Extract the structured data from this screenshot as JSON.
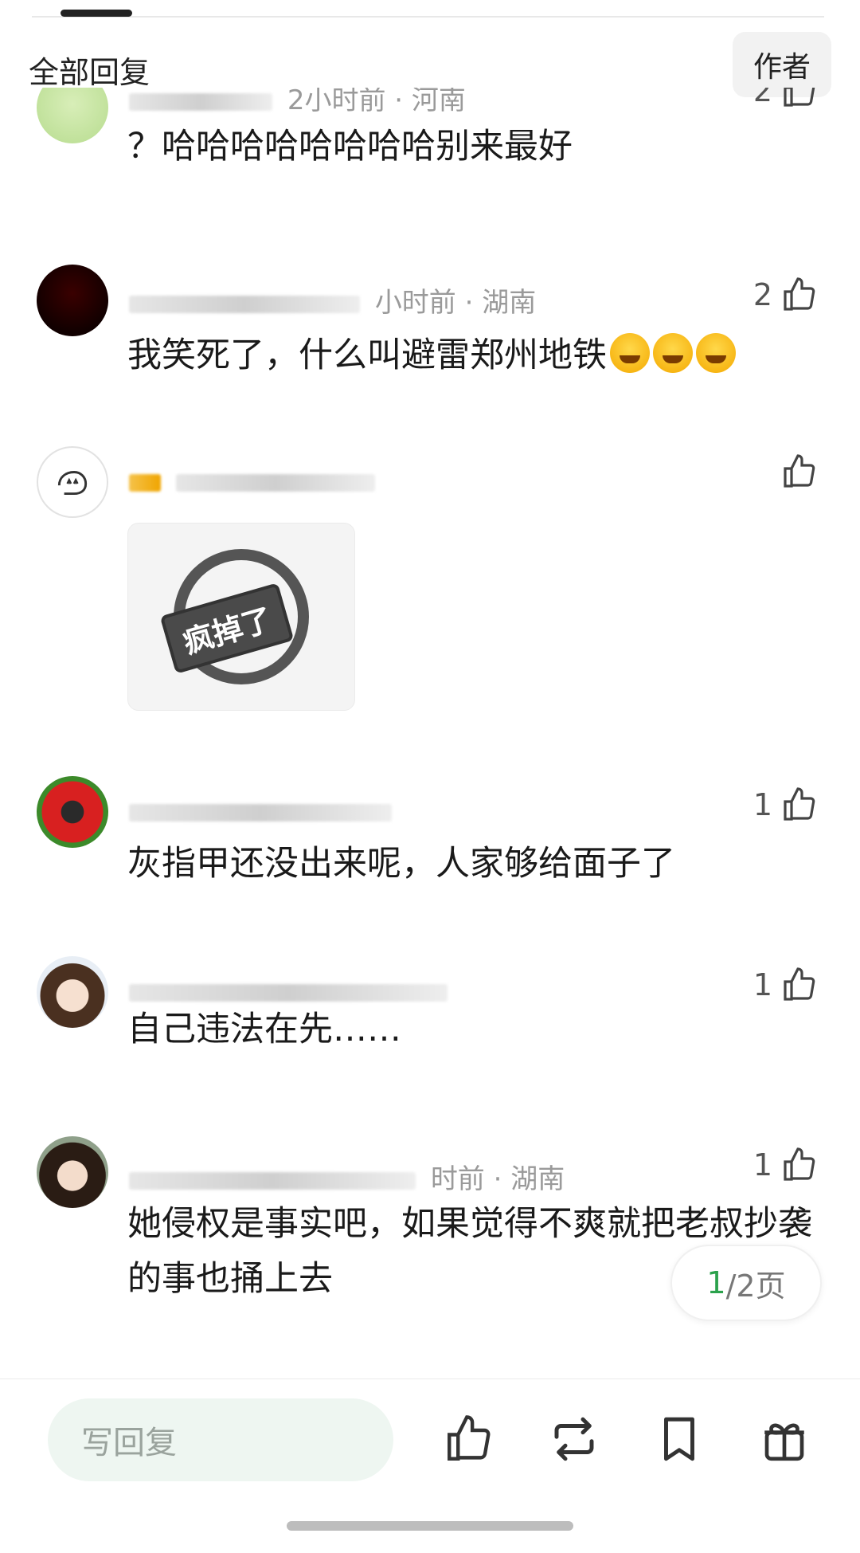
{
  "header": {
    "title": "全部回复",
    "author_button": "作者"
  },
  "comments": [
    {
      "meta": "2小时前 · 河南",
      "likes": "2",
      "text": "？哈哈哈哈哈哈哈哈别来最好"
    },
    {
      "meta": "小时前 · 湖南",
      "likes": "2",
      "text": "我笑死了，什么叫避雷郑州地铁"
    },
    {
      "meta": "",
      "likes": "",
      "sticker_text": "疯掉了"
    },
    {
      "meta": "",
      "likes": "1",
      "text": "灰指甲还没出来呢，人家够给面子了"
    },
    {
      "meta": "",
      "likes": "1",
      "text": "自己违法在先……"
    },
    {
      "meta": "时前 · 湖南",
      "likes": "1",
      "text": "她侵权是事实吧，如果觉得不爽就把老叔抄袭的事也捅上去"
    }
  ],
  "pagination": {
    "current": "1",
    "rest": "/2页"
  },
  "bottom": {
    "reply_placeholder": "写回复"
  },
  "colors": {
    "accent": "#2ba24c",
    "input_bg": "#eef6f1"
  },
  "icons": [
    "thumbs-up-icon",
    "repost-icon",
    "bookmark-icon",
    "gift-icon"
  ]
}
